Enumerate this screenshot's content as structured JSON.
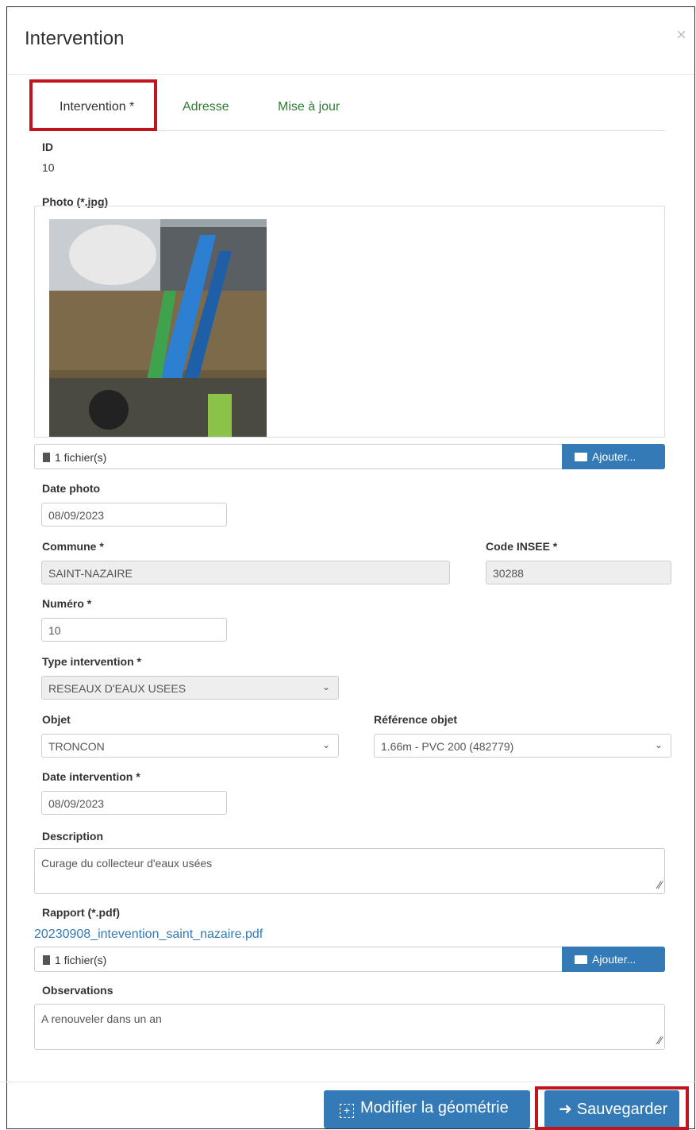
{
  "modal": {
    "title": "Intervention",
    "close": "×"
  },
  "tabs": [
    "Intervention *",
    "Adresse",
    "Mise à jour"
  ],
  "fields": {
    "id_label": "ID",
    "id_value": "10",
    "photo_label": "Photo (*.jpg)",
    "photo_files": "1 fichier(s)",
    "add_label": "Ajouter...",
    "date_photo_label": "Date photo",
    "date_photo_value": "08/09/2023",
    "commune_label": "Commune *",
    "commune_value": "SAINT-NAZAIRE",
    "insee_label": "Code INSEE *",
    "insee_value": "30288",
    "numero_label": "Numéro *",
    "numero_value": "10",
    "type_label": "Type intervention *",
    "type_value": "RESEAUX D'EAUX USEES",
    "objet_label": "Objet",
    "objet_value": "TRONCON",
    "ref_label": "Référence objet",
    "ref_value": "1.66m - PVC 200 (482779)",
    "date_interv_label": "Date intervention *",
    "date_interv_value": "08/09/2023",
    "description_label": "Description",
    "description_value": "Curage du collecteur d'eaux usées",
    "rapport_label": "Rapport (*.pdf)",
    "rapport_link": "20230908_intevention_saint_nazaire.pdf",
    "rapport_files": "1 fichier(s)",
    "observations_label": "Observations",
    "observations_value": "A renouveler dans un an"
  },
  "footer": {
    "modify_label": "Modifier la géométrie",
    "save_label": "Sauvegarder"
  }
}
